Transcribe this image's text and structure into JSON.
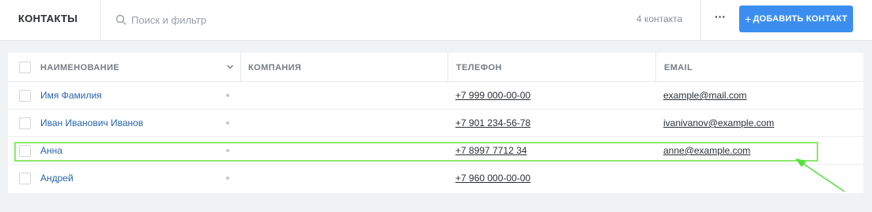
{
  "header": {
    "title": "КОНТАКТЫ",
    "search_placeholder": "Поиск и фильтр",
    "count": "4 контакта",
    "more_label": "···",
    "add_button_label": "ДОБАВИТЬ КОНТАКТ",
    "accent_color": "#3b8ef0"
  },
  "table": {
    "columns": {
      "name": "НАИМЕНОВАНИЕ",
      "company": "КОМПАНИЯ",
      "phone": "ТЕЛЕФОН",
      "email": "EMAIL"
    },
    "rows": [
      {
        "name": "Имя Фамилия",
        "phone": "+7 999 000-00-00",
        "email": "example@mail.com"
      },
      {
        "name": "Иван Иванович Иванов",
        "phone": "+7 901 234-56-78",
        "email": "ivanivanov@example.com"
      },
      {
        "name": "Анна",
        "phone": "+7 8997 7712 34",
        "email": "anne@example.com"
      },
      {
        "name": "Андрей",
        "phone": "+7 960 000-00-00",
        "email": ""
      }
    ]
  },
  "annotation": {
    "highlight_color": "#8fe86a",
    "highlighted_row": "Анна"
  }
}
